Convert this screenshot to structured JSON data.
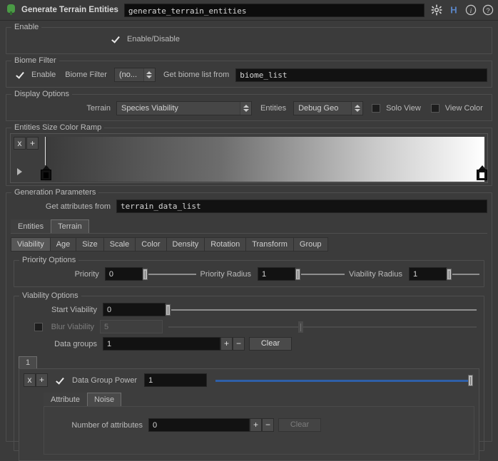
{
  "titlebar": {
    "node_icon": "terrain-node-icon",
    "title": "Generate Terrain Entities",
    "name_value": "generate_terrain_entities",
    "icons": [
      {
        "name": "gear-icon",
        "glyph": "⚙"
      },
      {
        "name": "houdini-h-icon",
        "glyph": "H"
      },
      {
        "name": "info-icon",
        "glyph": "i"
      },
      {
        "name": "help-icon",
        "glyph": "?"
      }
    ],
    "accent_blue": "#5a86c8"
  },
  "enable_group": {
    "label": "Enable",
    "checkbox_label": "Enable/Disable",
    "checked": true
  },
  "biome_filter": {
    "label": "Biome Filter",
    "enable_label": "Enable",
    "enable_checked": true,
    "filter_label": "Biome Filter",
    "filter_value": "(no...",
    "get_list_label": "Get biome list from",
    "list_value": "biome_list"
  },
  "display_options": {
    "label": "Display Options",
    "terrain_label": "Terrain",
    "terrain_value": "Species Viability",
    "entities_label": "Entities",
    "entities_value": "Debug Geo",
    "solo_view_label": "Solo View",
    "solo_view_checked": false,
    "view_color_label": "View Color",
    "view_color_checked": false
  },
  "color_ramp": {
    "label": "Entities Size Color Ramp",
    "remove_button": "x",
    "add_button": "+",
    "expand_icon": "play-triangle-icon",
    "keys": [
      {
        "position": 0,
        "color": "#000000"
      },
      {
        "position": 100,
        "color": "#ffffff"
      }
    ]
  },
  "generation_parameters": {
    "label": "Generation Parameters",
    "get_attributes_label": "Get attributes from",
    "get_attributes_value": "terrain_data_list",
    "main_tabs": [
      {
        "label": "Entities",
        "selected": false
      },
      {
        "label": "Terrain",
        "selected": true
      }
    ],
    "type_tabs": [
      {
        "label": "Viability",
        "selected": true
      },
      {
        "label": "Age",
        "selected": false
      },
      {
        "label": "Size",
        "selected": false
      },
      {
        "label": "Scale",
        "selected": false
      },
      {
        "label": "Color",
        "selected": false
      },
      {
        "label": "Density",
        "selected": false
      },
      {
        "label": "Rotation",
        "selected": false
      },
      {
        "label": "Transform",
        "selected": false
      },
      {
        "label": "Group",
        "selected": false
      }
    ]
  },
  "priority_options": {
    "label": "Priority Options",
    "priority_label": "Priority",
    "priority_value": "0",
    "priority_radius_label": "Priority Radius",
    "priority_radius_value": "1",
    "viability_radius_label": "Viability Radius",
    "viability_radius_value": "1"
  },
  "viability_options": {
    "label": "Viability Options",
    "start_viability_label": "Start Viability",
    "start_viability_value": "0",
    "blur_viability_label": "Blur Viability",
    "blur_viability_value": "5",
    "blur_enabled": false,
    "data_groups_label": "Data groups",
    "data_groups_value": "1",
    "add_button": "+",
    "remove_button": "−",
    "clear_button": "Clear",
    "group_tab_label": "1",
    "data_group": {
      "remove_button": "x",
      "add_button": "+",
      "enabled": true,
      "power_label": "Data Group Power",
      "power_value": "1",
      "slider_color": "#2f5fa8",
      "tabs": [
        {
          "label": "Attribute",
          "selected": false
        },
        {
          "label": "Noise",
          "selected": true
        }
      ],
      "attributes_label": "Number of attributes",
      "attributes_value": "0",
      "attr_add_button": "+",
      "attr_remove_button": "−",
      "attr_clear_button": "Clear"
    }
  }
}
